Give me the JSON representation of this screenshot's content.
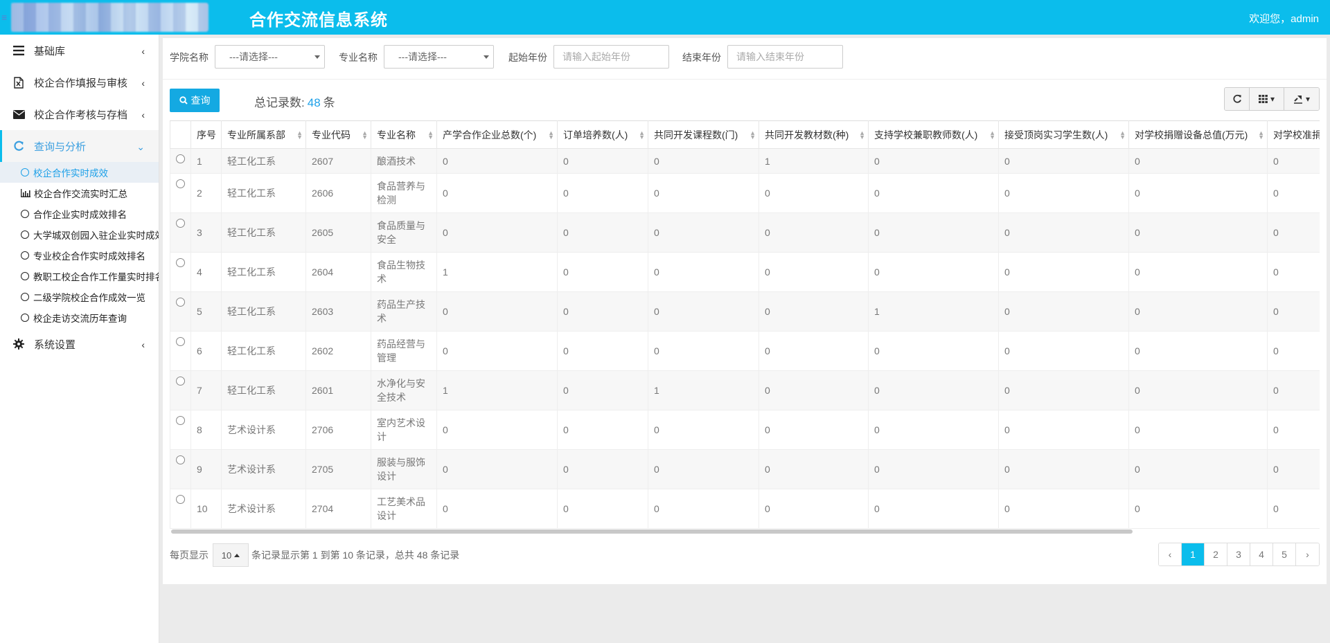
{
  "header": {
    "title": "合作交流信息系统",
    "welcome": "欢迎您，admin"
  },
  "sidebar": {
    "items": [
      {
        "label": "基础库",
        "icon": "menu-icon"
      },
      {
        "label": "校企合作填报与审核",
        "icon": "excel-file-icon"
      },
      {
        "label": "校企合作考核与存档",
        "icon": "envelope-icon"
      },
      {
        "label": "查询与分析",
        "icon": "refresh-icon"
      },
      {
        "label": "系统设置",
        "icon": "gear-icon"
      }
    ],
    "subitems": [
      "校企合作实时成效",
      "校企合作交流实时汇总",
      "合作企业实时成效排名",
      "大学城双创园入驻企业实时成效",
      "专业校企合作实时成效排名",
      "教职工校企合作工作量实时排名",
      "二级学院校企合作成效一览",
      "校企走访交流历年查询"
    ]
  },
  "filters": {
    "college_label": "学院名称",
    "college_value": "---请选择---",
    "major_label": "专业名称",
    "major_value": "---请选择---",
    "start_label": "起始年份",
    "start_placeholder": "请输入起始年份",
    "end_label": "结束年份",
    "end_placeholder": "请输入结束年份"
  },
  "toolbar": {
    "query_label": "查询",
    "total_prefix": "总记录数:",
    "total_count": "48",
    "total_suffix": "条"
  },
  "table": {
    "headers": [
      "序号",
      "专业所属系部",
      "专业代码",
      "专业名称",
      "产学合作企业总数(个)",
      "订单培养数(人)",
      "共同开发课程数(门)",
      "共同开发教材数(种)",
      "支持学校兼职教师数(人)",
      "接受顶岗实习学生数(人)",
      "对学校捐赠设备总值(万元)",
      "对学校准捐"
    ],
    "rows": [
      [
        "1",
        "轻工化工系",
        "2607",
        "酿酒技术",
        "0",
        "0",
        "0",
        "1",
        "0",
        "0",
        "0",
        "0"
      ],
      [
        "2",
        "轻工化工系",
        "2606",
        "食品营养与检测",
        "0",
        "0",
        "0",
        "0",
        "0",
        "0",
        "0",
        "0"
      ],
      [
        "3",
        "轻工化工系",
        "2605",
        "食品质量与安全",
        "0",
        "0",
        "0",
        "0",
        "0",
        "0",
        "0",
        "0"
      ],
      [
        "4",
        "轻工化工系",
        "2604",
        "食品生物技术",
        "1",
        "0",
        "0",
        "0",
        "0",
        "0",
        "0",
        "0"
      ],
      [
        "5",
        "轻工化工系",
        "2603",
        "药品生产技术",
        "0",
        "0",
        "0",
        "0",
        "1",
        "0",
        "0",
        "0"
      ],
      [
        "6",
        "轻工化工系",
        "2602",
        "药品经营与管理",
        "0",
        "0",
        "0",
        "0",
        "0",
        "0",
        "0",
        "0"
      ],
      [
        "7",
        "轻工化工系",
        "2601",
        "水净化与安全技术",
        "1",
        "0",
        "1",
        "0",
        "0",
        "0",
        "0",
        "0"
      ],
      [
        "8",
        "艺术设计系",
        "2706",
        "室内艺术设计",
        "0",
        "0",
        "0",
        "0",
        "0",
        "0",
        "0",
        "0"
      ],
      [
        "9",
        "艺术设计系",
        "2705",
        "服装与服饰设计",
        "0",
        "0",
        "0",
        "0",
        "0",
        "0",
        "0",
        "0"
      ],
      [
        "10",
        "艺术设计系",
        "2704",
        "工艺美术品设计",
        "0",
        "0",
        "0",
        "0",
        "0",
        "0",
        "0",
        "0"
      ]
    ]
  },
  "pagination": {
    "per_page_label": "每页显示",
    "page_size": "10",
    "summary": "条记录显示第 1 到第 10 条记录，总共 48 条记录",
    "prev": "‹",
    "pages": [
      "1",
      "2",
      "3",
      "4",
      "5"
    ],
    "next": "›"
  },
  "colors": {
    "brand": "#0bbdec",
    "link": "#1da0e8"
  }
}
